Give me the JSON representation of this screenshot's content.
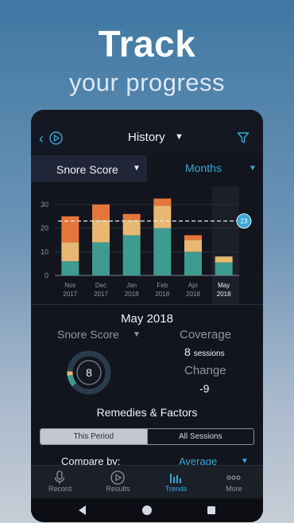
{
  "hero": {
    "title": "Track",
    "subtitle": "your progress"
  },
  "appbar": {
    "title": "History",
    "back_icon": "chevron-left-icon",
    "play_icon": "play-circle-icon",
    "filter_icon": "filter-icon",
    "accent": "#3aa7d6"
  },
  "selectors": {
    "metric": "Snore Score",
    "period": "Months"
  },
  "chart_data": {
    "type": "bar",
    "stacked": true,
    "categories": [
      "Nov\n2017",
      "Dec\n2017",
      "Jan\n2018",
      "Feb\n2018",
      "Apr\n2018",
      "May\n2018"
    ],
    "category_labels": [
      {
        "month": "Nov",
        "year": "2017"
      },
      {
        "month": "Dec",
        "year": "2017"
      },
      {
        "month": "Jan",
        "year": "2018"
      },
      {
        "month": "Feb",
        "year": "2018"
      },
      {
        "month": "Apr",
        "year": "2018"
      },
      {
        "month": "May",
        "year": "2018"
      }
    ],
    "series": [
      {
        "color": "#3f9a8f",
        "values": [
          6,
          14,
          17,
          20,
          10,
          5.5
        ]
      },
      {
        "color": "#e8b872",
        "values": [
          8,
          9.5,
          6.5,
          9.5,
          5,
          2.5
        ]
      },
      {
        "color": "#e5763a",
        "values": [
          11,
          6.5,
          2.5,
          3,
          2,
          0
        ]
      }
    ],
    "totals": [
      25,
      30,
      26,
      32.5,
      17,
      8
    ],
    "yticks": [
      0,
      10,
      20,
      30
    ],
    "ylim": [
      0,
      35
    ],
    "reference_line": {
      "value": 23,
      "label": "23"
    },
    "selected_index": 5,
    "grid": true
  },
  "detail": {
    "title": "May 2018",
    "score_label": "Snore Score",
    "score_value": "8",
    "score_fraction": 0.08,
    "coverage_label": "Coverage",
    "coverage_number": "8",
    "coverage_unit": "sessions",
    "change_label": "Change",
    "change_value": "-9"
  },
  "remedies": {
    "title": "Remedies & Factors",
    "tabs": [
      "This Period",
      "All Sessions"
    ],
    "compare_label": "Compare by:",
    "compare_value": "Average"
  },
  "tabbar": {
    "tabs": [
      {
        "label": "Record",
        "icon": "microphone-icon"
      },
      {
        "label": "Results",
        "icon": "play-circle-icon"
      },
      {
        "label": "Trends",
        "icon": "bar-chart-icon"
      },
      {
        "label": "More",
        "icon": "more-dots-icon"
      }
    ],
    "active": "Trends"
  },
  "system_nav": {
    "back": "back-triangle-icon",
    "home": "home-circle-icon",
    "recents": "recents-square-icon"
  }
}
